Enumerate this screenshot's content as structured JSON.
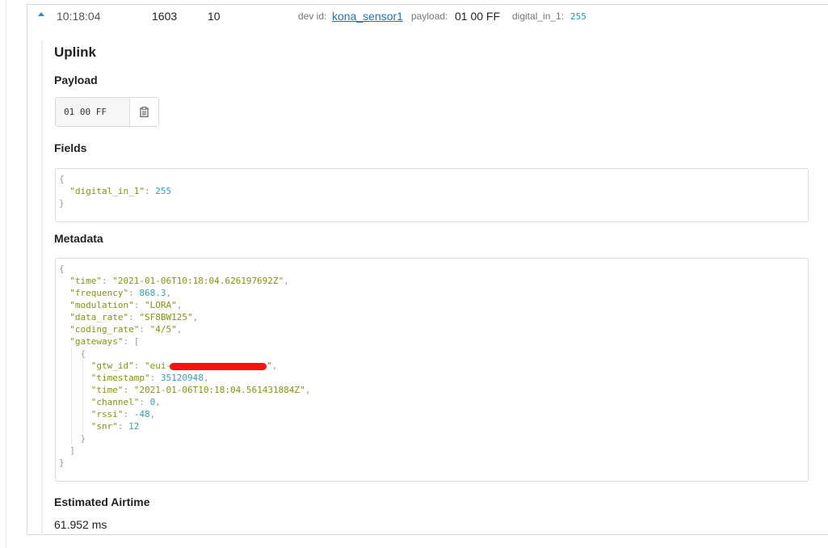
{
  "row": {
    "time": "10:18:04",
    "counter": "1603",
    "port": "10",
    "dev_id_label": "dev id:",
    "dev_id": "kona_sensor1",
    "payload_label": "payload:",
    "payload": "01 00 FF",
    "field_label": "digital_in_1:",
    "field_value": "255"
  },
  "detail": {
    "title": "Uplink",
    "payload_heading": "Payload",
    "payload_hex": "01 00 FF",
    "fields_heading": "Fields",
    "metadata_heading": "Metadata",
    "airtime_heading": "Estimated Airtime",
    "airtime_value": "61.952 ms"
  },
  "fields_json": {
    "digital_in_1": "255"
  },
  "metadata_json": {
    "time": "2021-01-06T10:18:04.626197692Z",
    "frequency": "868.3",
    "modulation": "LORA",
    "data_rate": "SF8BW125",
    "coding_rate": "4/5",
    "gateway": {
      "gtw_id_prefix": "eui-",
      "timestamp": "35120948",
      "time": "2021-01-06T10:18:04.561431884Z",
      "channel": "0",
      "rssi": "-48",
      "snr": "12"
    }
  },
  "colors": {
    "accent": "#2b8ecb",
    "link": "#1c73b8",
    "json_string": "#85950a",
    "json_number": "#2fa4b7",
    "redaction": "#ff1111"
  },
  "icons": {
    "expand": "caret-up-icon",
    "copy": "clipboard-icon"
  }
}
